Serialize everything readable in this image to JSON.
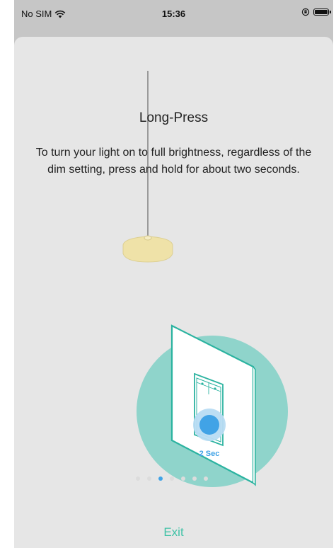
{
  "status": {
    "carrier": "No SIM",
    "time": "15:36",
    "wifi_icon": "wifi-icon",
    "orientation_icon": "orientation-lock-icon",
    "battery_icon": "battery-icon"
  },
  "content": {
    "title": "Long-Press",
    "description": "To turn your light on to full brightness, regardless of the dim setting, press and hold for about two seconds.",
    "press_duration_label": "2 Sec"
  },
  "pagination": {
    "total": 7,
    "active_index": 2
  },
  "actions": {
    "exit_label": "Exit"
  },
  "colors": {
    "accent": "#3fc2a6",
    "teal_circle": "#8fd4cb",
    "switch_outline": "#2bb3a0",
    "press_blue": "#41a3e6",
    "lamp": "#efe2a8"
  }
}
